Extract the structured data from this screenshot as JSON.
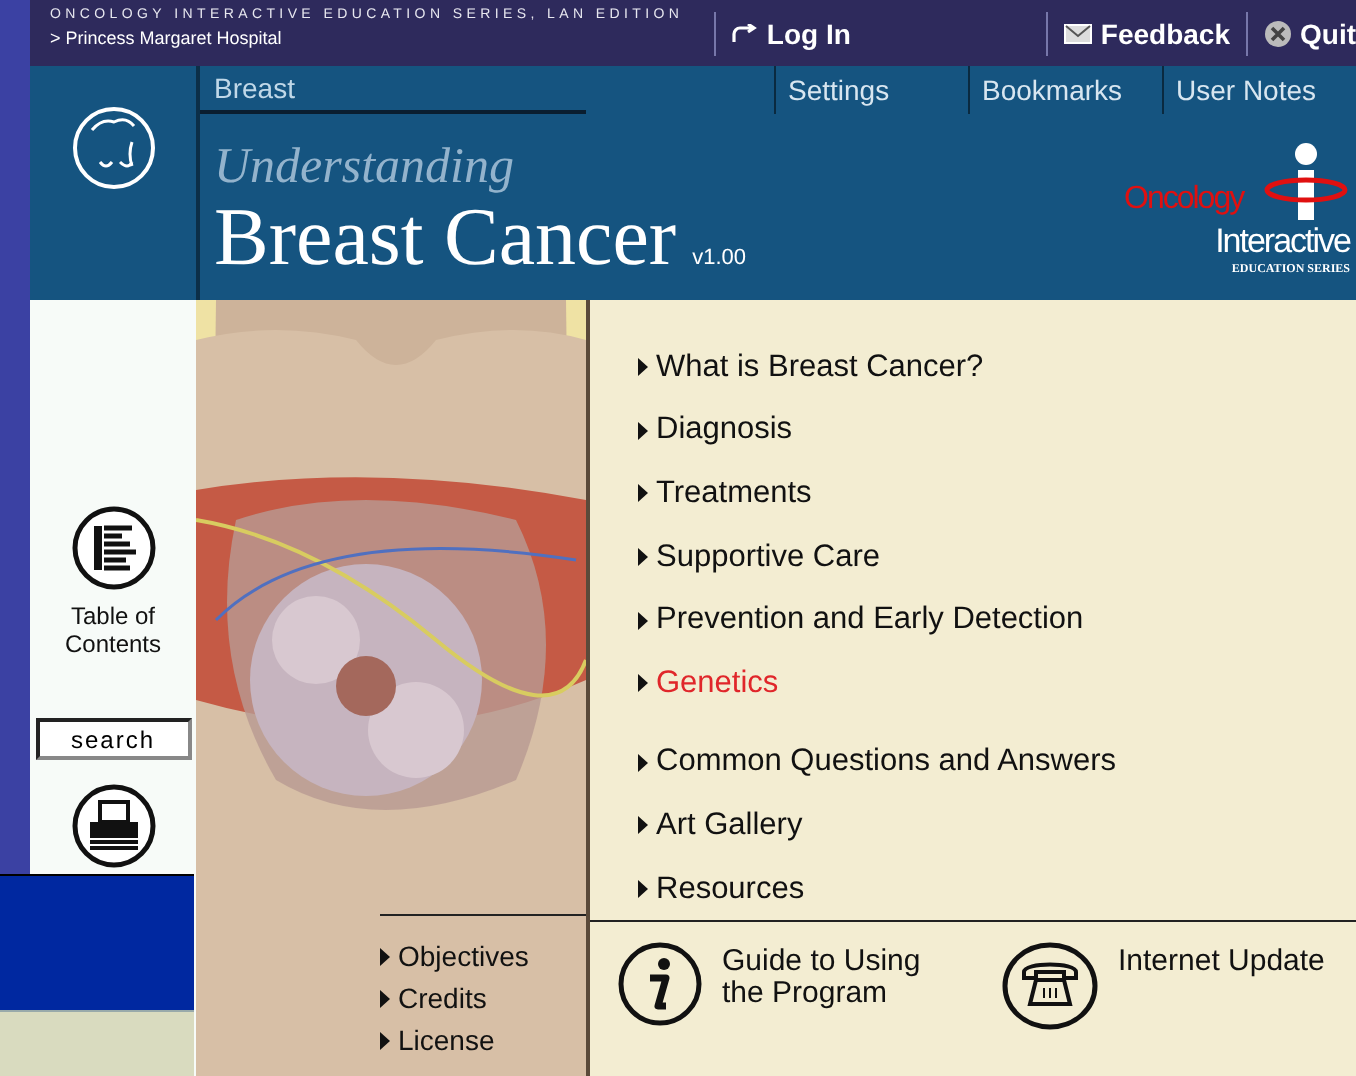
{
  "top_bar": {
    "series": "ONCOLOGY INTERACTIVE EDUCATION SERIES, LAN EDITION",
    "hospital": "> Princess Margaret Hospital",
    "actions": [
      {
        "kind": "login",
        "label": "Log In"
      },
      {
        "kind": "feedback",
        "label": "Feedback"
      },
      {
        "kind": "quit",
        "label": "Quit"
      }
    ]
  },
  "header": {
    "section": "Breast",
    "nav": [
      "Settings",
      "Bookmarks",
      "User Notes"
    ],
    "title_small": "Understanding",
    "title": "Breast Cancer",
    "version": "v1.00",
    "brand": {
      "line1": "Oncology",
      "line2": "Interactive",
      "line3": "EDUCATION SERIES"
    }
  },
  "sidebar": {
    "toc_label": "Table of Contents",
    "search": "search"
  },
  "menu_groups": [
    [
      {
        "label": "What is Breast Cancer?",
        "selected": false
      },
      {
        "label": "Diagnosis",
        "selected": false
      },
      {
        "label": "Treatments",
        "selected": false
      },
      {
        "label": "Supportive Care",
        "selected": false
      },
      {
        "label": "Prevention and Early Detection",
        "selected": false
      },
      {
        "label": "Genetics",
        "selected": true
      }
    ],
    [
      {
        "label": "Common Questions and Answers",
        "selected": false
      },
      {
        "label": "Art Gallery",
        "selected": false
      },
      {
        "label": "Resources",
        "selected": false
      }
    ]
  ],
  "footer_links": [
    "Objectives",
    "Credits",
    "License"
  ],
  "tools": [
    {
      "kind": "guide",
      "label": "Guide to Using the Program"
    },
    {
      "kind": "update",
      "label": "Internet Update"
    }
  ]
}
